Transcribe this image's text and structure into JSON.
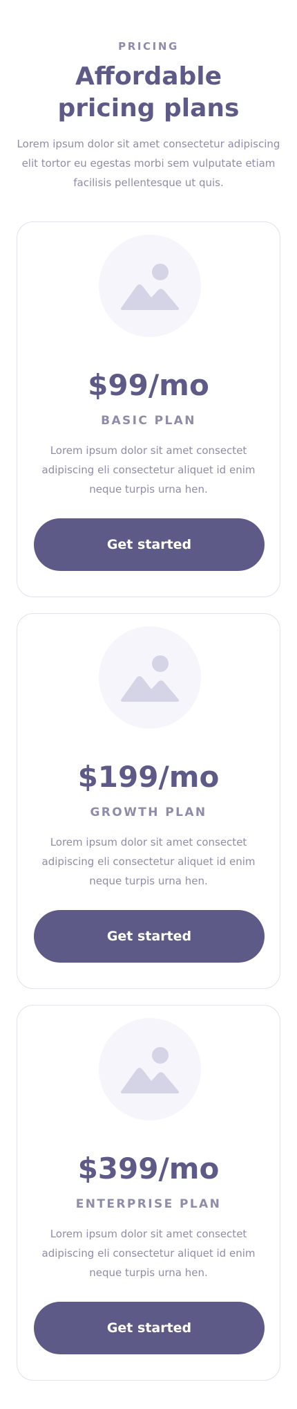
{
  "header": {
    "eyebrow": "PRICING",
    "title": "Affordable pricing plans",
    "subtitle": "Lorem ipsum dolor sit amet consectetur adipiscing elit tortor eu egestas morbi sem vulputate etiam facilisis pellentesque ut quis."
  },
  "colors": {
    "primary": "#5e5a87",
    "muted_text": "#8f8ca9",
    "card_border": "#e2e1ec",
    "image_bg": "#f6f5fc",
    "image_icon": "#d5d3e6"
  },
  "plans": [
    {
      "icon": "image-placeholder-icon",
      "price": "$99/mo",
      "name": "BASIC PLAN",
      "description": "Lorem ipsum dolor sit amet consectet adipiscing eli consectetur aliquet id enim neque turpis urna hen.",
      "button_label": "Get started"
    },
    {
      "icon": "image-placeholder-icon",
      "price": "$199/mo",
      "name": "GROWTH PLAN",
      "description": "Lorem ipsum dolor sit amet consectet adipiscing eli consectetur aliquet id enim neque turpis urna hen.",
      "button_label": "Get started"
    },
    {
      "icon": "image-placeholder-icon",
      "price": "$399/mo",
      "name": "ENTERPRISE PLAN",
      "description": "Lorem ipsum dolor sit amet consectet adipiscing eli consectetur aliquet id enim neque turpis urna hen.",
      "button_label": "Get started"
    }
  ]
}
